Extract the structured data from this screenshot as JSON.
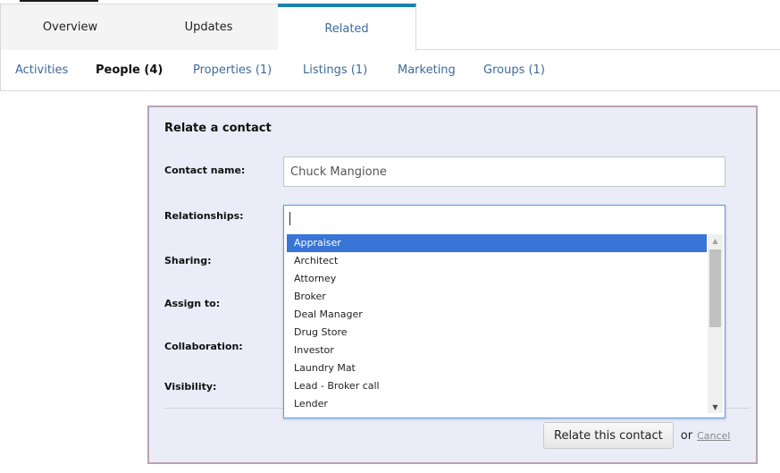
{
  "tabs": [
    {
      "label": "Overview",
      "active": false
    },
    {
      "label": "Updates",
      "active": false
    },
    {
      "label": "Related",
      "active": true
    }
  ],
  "subnav": [
    {
      "label": "Activities",
      "active": false
    },
    {
      "label": "People (4)",
      "active": true
    },
    {
      "label": "Properties (1)",
      "active": false
    },
    {
      "label": "Listings (1)",
      "active": false
    },
    {
      "label": "Marketing",
      "active": false
    },
    {
      "label": "Groups (1)",
      "active": false
    }
  ],
  "form": {
    "title": "Relate a contact",
    "labels": {
      "contact_name": "Contact name:",
      "relationships": "Relationships:",
      "sharing": "Sharing:",
      "assign_to": "Assign to:",
      "collaboration": "Collaboration:",
      "visibility": "Visibility:"
    },
    "contact_name_value": "Chuck Mangione",
    "relationships_value": "",
    "relationship_options": [
      "Appraiser",
      "Architect",
      "Attorney",
      "Broker",
      "Deal Manager",
      "Drug Store",
      "Investor",
      "Laundry Mat",
      "Lead - Broker call",
      "Lender"
    ],
    "highlighted_option": "Appraiser",
    "submit_label": "Relate this contact",
    "or_text": "or",
    "cancel_label": "Cancel"
  },
  "icons": {
    "scroll_up": "▲",
    "scroll_down": "▼"
  },
  "colors": {
    "accent_tab": "#1d7fb0",
    "link": "#3e6b9a",
    "panel_bg": "#eaedf8",
    "panel_border": "#b9a2b3",
    "selected_option": "#3875d7"
  }
}
